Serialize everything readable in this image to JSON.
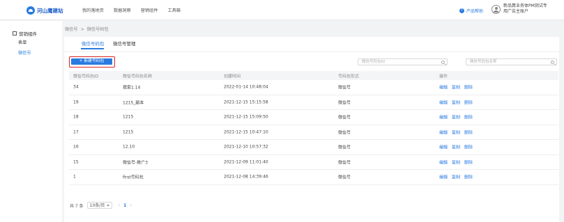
{
  "app": {
    "name": "河山鹰建站"
  },
  "topnav": [
    "我的落地页",
    "数据洞察",
    "营销组件",
    "工具箱"
  ],
  "header": {
    "help": "产品帮助",
    "user_line1": "新品算业务体PM测试专",
    "user_line2": "用广告主账户"
  },
  "sidebar": {
    "title": "营销组件",
    "items": [
      {
        "label": "表单"
      },
      {
        "label": "微信号"
      }
    ]
  },
  "breadcrumb": {
    "parent": "微信号",
    "sep": ">",
    "current": "微信号码包"
  },
  "tabs": [
    {
      "label": "微信号码包"
    },
    {
      "label": "微信号管理"
    }
  ],
  "toolbar": {
    "new_label": "+ 新建号码包"
  },
  "search": {
    "id_placeholder": "微信号码包ID",
    "name_placeholder": "微信号码包名称"
  },
  "table": {
    "headers": [
      "微信号码包ID",
      "微信号码包名称",
      "创建时间",
      "号码包形式",
      "操作"
    ],
    "rows": [
      {
        "id": "34",
        "name": "搜索1.14",
        "created": "2022-01-14 10:48:04",
        "form": "微信号"
      },
      {
        "id": "19",
        "name": "1215_副本",
        "created": "2021-12-15 15:15:58",
        "form": "微信号"
      },
      {
        "id": "18",
        "name": "1215",
        "created": "2021-12-15 15:09:50",
        "form": "微信号"
      },
      {
        "id": "17",
        "name": "1215",
        "created": "2021-12-15 10:47:10",
        "form": "微信号"
      },
      {
        "id": "16",
        "name": "12.10",
        "created": "2021-12-10 10:57:32",
        "form": "微信号"
      },
      {
        "id": "15",
        "name": "微信号-推广3",
        "created": "2021-12-09 11:01:40",
        "form": "微信号"
      },
      {
        "id": "1",
        "name": "first号码包",
        "created": "2021-12-08 14:39:46",
        "form": "微信号"
      }
    ],
    "actions": {
      "edit": "编辑",
      "copy": "复制",
      "delete": "删除"
    }
  },
  "pagination": {
    "total": "共 7 条",
    "page_size": "10条/页",
    "prev": "‹",
    "current": "1",
    "next": "›"
  },
  "colors": {
    "accent": "#2a7be0",
    "highlight_border": "#e02020"
  }
}
